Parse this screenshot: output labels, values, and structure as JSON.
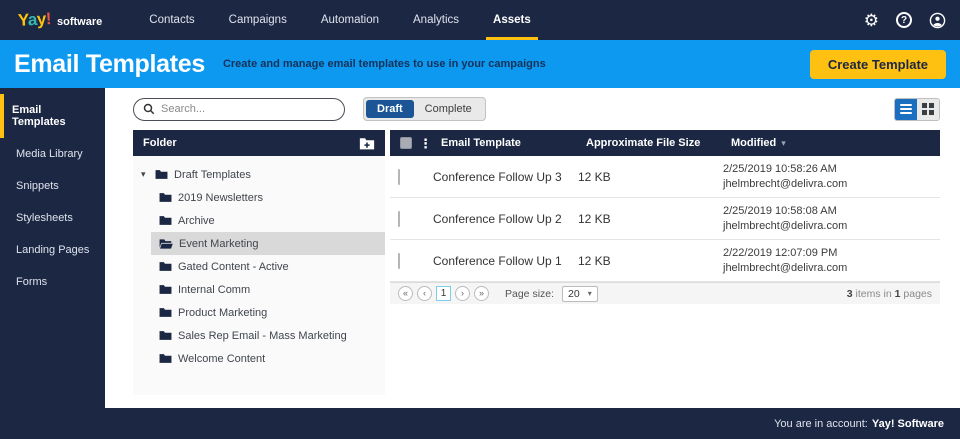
{
  "topnav": {
    "logo": {
      "l1": "Y",
      "l2": "a",
      "l3": "y",
      "l4": "!",
      "software": "software"
    },
    "items": [
      {
        "label": "Contacts"
      },
      {
        "label": "Campaigns"
      },
      {
        "label": "Automation"
      },
      {
        "label": "Analytics"
      },
      {
        "label": "Assets",
        "active": true
      }
    ],
    "icons": {
      "settings_glyph": "⚙",
      "help_glyph": "?"
    }
  },
  "header": {
    "title": "Email Templates",
    "subtitle": "Create and manage email templates to use in your campaigns",
    "create_button_label": "Create Template"
  },
  "sidebar": {
    "items": [
      {
        "label": "Email Templates",
        "active": true
      },
      {
        "label": "Media Library"
      },
      {
        "label": "Snippets"
      },
      {
        "label": "Stylesheets"
      },
      {
        "label": "Landing Pages"
      },
      {
        "label": "Forms"
      }
    ]
  },
  "toolbar": {
    "search_placeholder": "Search...",
    "filter_toggle": {
      "options": [
        "Draft",
        "Complete"
      ],
      "selected": "Draft"
    }
  },
  "folder_panel": {
    "header_label": "Folder",
    "tree": {
      "root": {
        "label": "Draft Templates",
        "expanded": true,
        "caret_glyph": "▾"
      },
      "children": [
        {
          "label": "2019 Newsletters"
        },
        {
          "label": "Archive"
        },
        {
          "label": "Event Marketing",
          "selected": true
        },
        {
          "label": "Gated Content - Active"
        },
        {
          "label": "Internal Comm"
        },
        {
          "label": "Product Marketing"
        },
        {
          "label": "Sales Rep Email - Mass Marketing"
        },
        {
          "label": "Welcome Content"
        }
      ]
    }
  },
  "grid": {
    "columns": {
      "name": "Email Template",
      "size": "Approximate File Size",
      "modified": "Modified"
    },
    "sort": {
      "column": "Modified",
      "direction": "desc",
      "glyph": "▾"
    },
    "rows": [
      {
        "name": "Conference Follow Up 3",
        "size": "12 KB",
        "modified_date": "2/25/2019 10:58:26 AM",
        "modified_by": "jhelmbrecht@delivra.com"
      },
      {
        "name": "Conference Follow Up 2",
        "size": "12 KB",
        "modified_date": "2/25/2019 10:58:08 AM",
        "modified_by": "jhelmbrecht@delivra.com"
      },
      {
        "name": "Conference Follow Up 1",
        "size": "12 KB",
        "modified_date": "2/22/2019 12:07:09 PM",
        "modified_by": "jhelmbrecht@delivra.com"
      }
    ]
  },
  "pagination": {
    "first_glyph": "«",
    "prev_glyph": "‹",
    "current_page": "1",
    "next_glyph": "›",
    "last_glyph": "»",
    "page_size_label": "Page size:",
    "page_size_value": "20",
    "dropdown_caret": "▾",
    "summary": {
      "items_count": "3",
      "text_a": " items in ",
      "pages_count": "1",
      "text_b": " pages"
    }
  },
  "footer": {
    "account_label": "You are in account:",
    "account_name": "Yay! Software"
  },
  "colors": {
    "navy": "#1b2743",
    "header_blue": "#0d99f0",
    "accent_yellow": "#fec111",
    "draft_blue": "#1b5596",
    "list_view_blue": "#1a6fc0",
    "selected_folder_bg": "#d9d9d9"
  }
}
